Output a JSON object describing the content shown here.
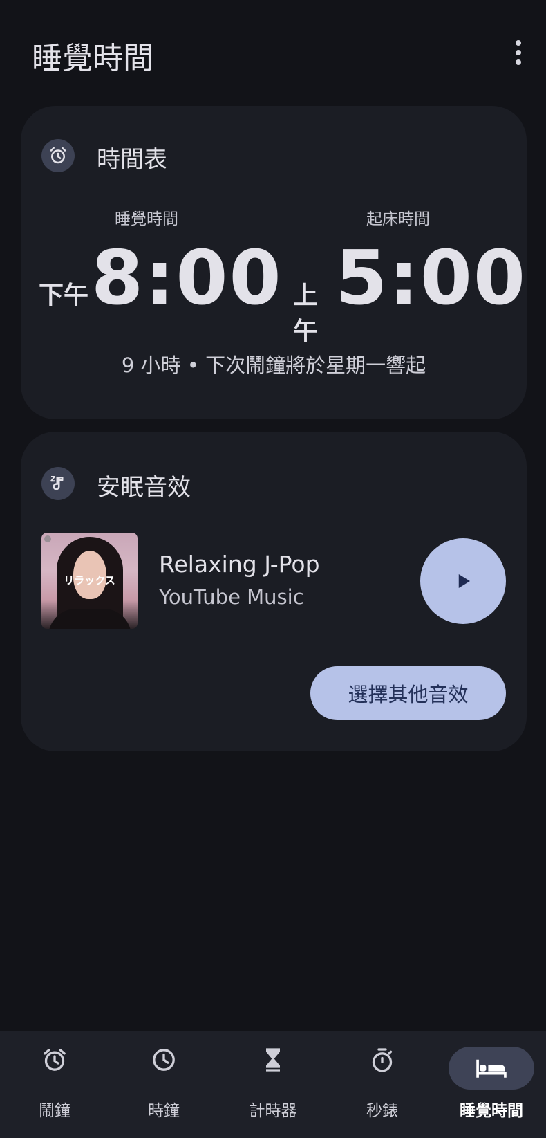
{
  "header": {
    "title": "睡覺時間"
  },
  "schedule": {
    "title": "時間表",
    "bedtime": {
      "label": "睡覺時間",
      "ampm": "下午",
      "time": "8:00"
    },
    "wake": {
      "label": "起床時間",
      "ampm": "上午",
      "time": "5:00"
    },
    "summary": "9 小時 • 下次鬧鐘將於星期一響起"
  },
  "sound": {
    "title": "安眠音效",
    "album_text": "リラックス",
    "track_title": "Relaxing J-Pop",
    "track_source": "YouTube Music",
    "choose_label": "選擇其他音效"
  },
  "nav": {
    "items": [
      {
        "label": "鬧鐘",
        "icon": "alarm-icon"
      },
      {
        "label": "時鐘",
        "icon": "clock-icon"
      },
      {
        "label": "計時器",
        "icon": "hourglass-icon"
      },
      {
        "label": "秒錶",
        "icon": "stopwatch-icon"
      },
      {
        "label": "睡覺時間",
        "icon": "bed-icon",
        "active": true
      }
    ]
  },
  "colors": {
    "background": "#121318",
    "card": "#1b1d24",
    "accent": "#b6c2e8",
    "navbar": "#1e2028"
  }
}
